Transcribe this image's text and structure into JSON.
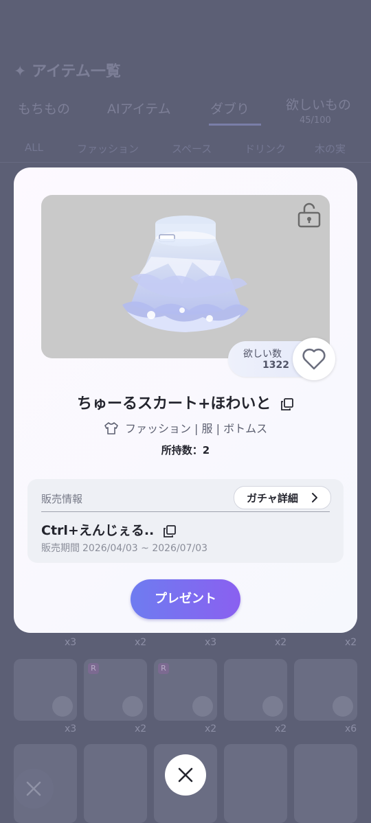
{
  "background": {
    "title": "✦ アイテム一覧",
    "tabs": [
      "もちもの",
      "AIアイテム",
      "ダブり",
      "欲しいもの"
    ],
    "wish_tab_count": "45/100",
    "filters": [
      "ALL",
      "ファッション",
      "スペース",
      "ドリンク",
      "木の実"
    ],
    "row1_counts": [
      "x3",
      "x2",
      "x3",
      "x2",
      "x2"
    ],
    "row2_counts": [
      "x3",
      "x2",
      "x2",
      "x2",
      "x6"
    ],
    "rarity_badge": "R"
  },
  "modal": {
    "wish_label": "欲しい数",
    "wish_count": "1322",
    "item_name": "ちゅーるスカート+ほわいと",
    "category": [
      "ファッション",
      "服",
      "ボトムス"
    ],
    "category_separator": "|",
    "owned": "所持数：2",
    "sales_label": "販売情報",
    "gacha_button": "ガチャ詳細",
    "gacha_name": "Ctrl+えんじぇる..",
    "sales_period_label": "販売期間",
    "sales_period": "2026/04/03 ~ 2026/07/03",
    "present_button": "プレゼント"
  },
  "icons": [
    "lock-open-icon",
    "heart-outline-icon",
    "copy-icon",
    "shirt-icon",
    "chevron-right-icon",
    "close-icon"
  ],
  "colors": {
    "accent_start": "#6e7cf0",
    "accent_end": "#8a60f0",
    "overlay": "#5c5f75"
  }
}
